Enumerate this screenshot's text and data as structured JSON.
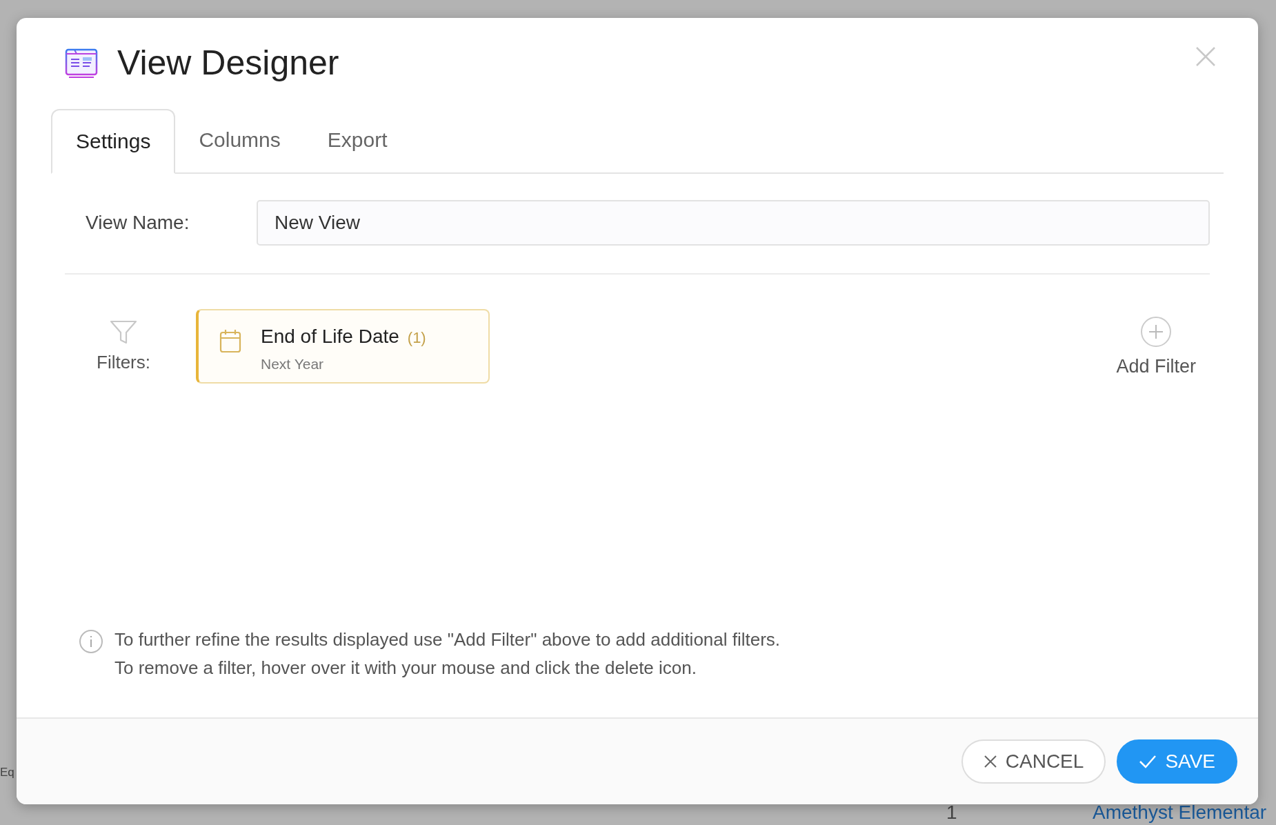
{
  "background": {
    "texts": [
      {
        "kind": "left",
        "text": "Eq"
      },
      {
        "kind": "count",
        "text": "1"
      },
      {
        "kind": "link",
        "text": "Amethyst Elementar"
      }
    ]
  },
  "dialog": {
    "title": "View Designer",
    "tabs": [
      {
        "label": "Settings",
        "selected": true
      },
      {
        "label": "Columns",
        "selected": false
      },
      {
        "label": "Export",
        "selected": false
      }
    ],
    "view_name": {
      "label": "View Name:",
      "value": "New View"
    },
    "filters": {
      "label": "Filters:",
      "items": [
        {
          "name": "End of Life Date",
          "count": "(1)",
          "value": "Next Year",
          "color": "#e8b53a"
        }
      ],
      "add_label": "Add Filter"
    },
    "info": [
      "To further refine the results displayed use \"Add Filter\" above to add additional filters.",
      "To remove a filter, hover over it with your mouse and click the delete icon."
    ],
    "buttons": [
      {
        "kind": "cancel",
        "label": "CANCEL"
      },
      {
        "kind": "save",
        "label": "SAVE"
      }
    ]
  }
}
